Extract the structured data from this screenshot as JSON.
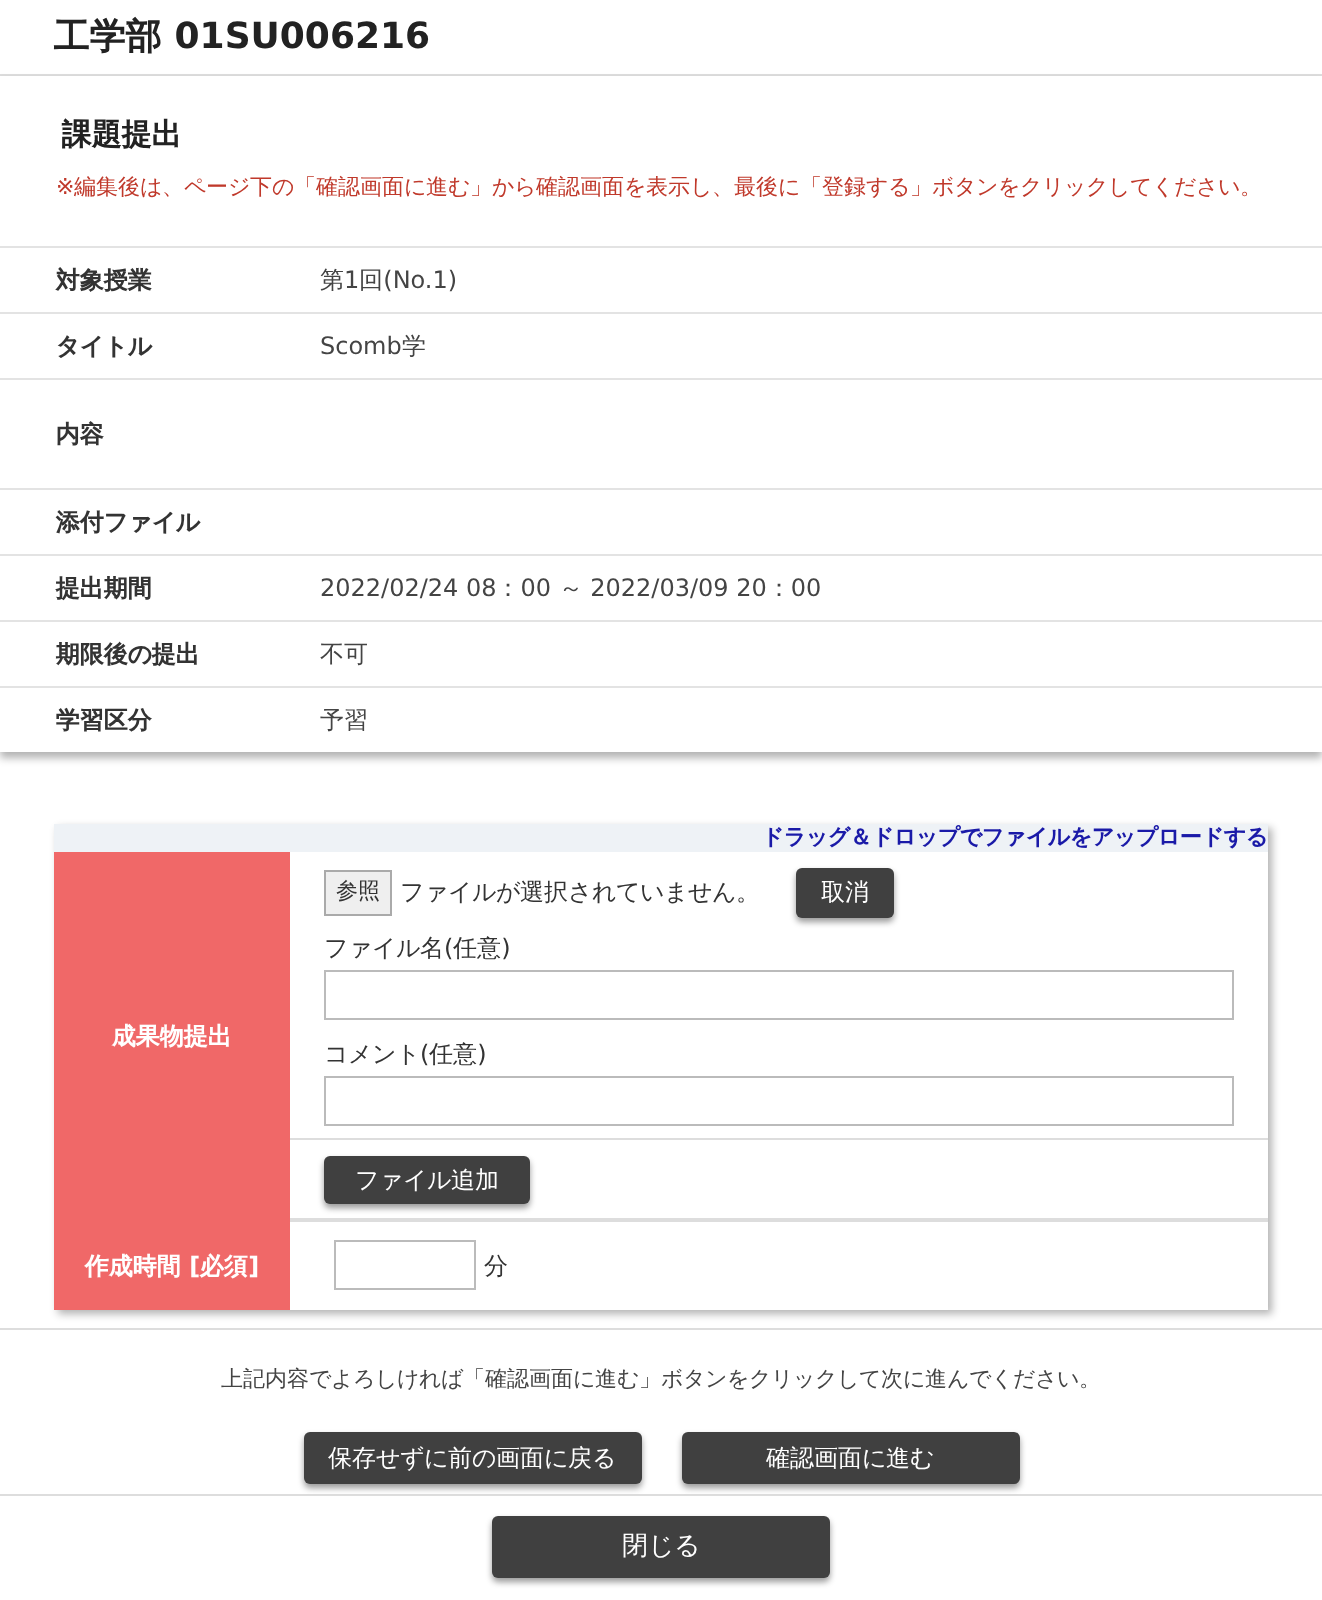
{
  "header": {
    "title": "工学部 01SU006216"
  },
  "section": {
    "title": "課題提出",
    "notice": "※編集後は、ページ下の「確認画面に進む」から確認画面を表示し、最後に「登録する」ボタンをクリックしてください。"
  },
  "info_rows": [
    {
      "label": "対象授業",
      "value": "第1回(No.1)"
    },
    {
      "label": "タイトル",
      "value": "Scomb学"
    },
    {
      "label": "内容",
      "value": ""
    },
    {
      "label": "添付ファイル",
      "value": ""
    },
    {
      "label": "提出期間",
      "value": "2022/02/24 08：00 ～ 2022/03/09 20：00"
    },
    {
      "label": "期限後の提出",
      "value": "不可"
    },
    {
      "label": "学習区分",
      "value": "予習"
    }
  ],
  "upload": {
    "drop_link": "ドラッグ＆ドロップでファイルをアップロードする",
    "label": "成果物提出",
    "browse_button": "参照",
    "file_status": "ファイルが選択されていません。",
    "cancel_button": "取消",
    "file_name_label": "ファイル名(任意)",
    "comment_label": "コメント(任意)",
    "add_file_button": "ファイル追加",
    "time_label": "作成時間 [必須]",
    "time_unit": "分"
  },
  "footer": {
    "instruction": "上記内容でよろしければ「確認画面に進む」ボタンをクリックして次に進んでください。",
    "back_button": "保存せずに前の画面に戻る",
    "confirm_button": "確認画面に進む",
    "close_button": "閉じる"
  }
}
